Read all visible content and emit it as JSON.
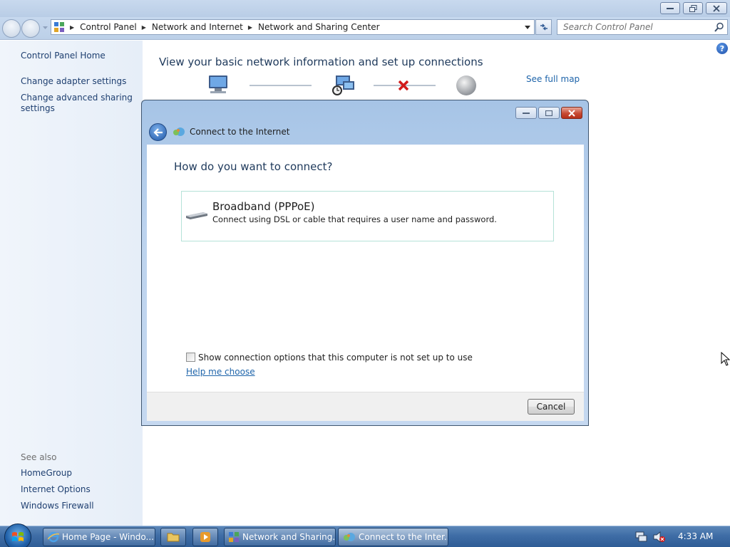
{
  "window": {
    "breadcrumbs": [
      "Control Panel",
      "Network and Internet",
      "Network and Sharing Center"
    ],
    "search_placeholder": "Search Control Panel"
  },
  "sidebar": {
    "items": [
      {
        "label": "Control Panel Home"
      },
      {
        "label": "Change adapter settings"
      },
      {
        "label": "Change advanced sharing settings"
      }
    ],
    "see_also_heading": "See also",
    "see_also": [
      {
        "label": "HomeGroup"
      },
      {
        "label": "Internet Options"
      },
      {
        "label": "Windows Firewall"
      }
    ]
  },
  "main": {
    "title": "View your basic network information and set up connections",
    "see_full_map": "See full map"
  },
  "dialog": {
    "title": "Connect to the Internet",
    "question": "How do you want to connect?",
    "option": {
      "title": "Broadband (PPPoE)",
      "description": "Connect using DSL or cable that requires a user name and password."
    },
    "checkbox_label": "Show connection options that this computer is not set up to use",
    "checkbox_checked": false,
    "help_link": "Help me choose",
    "cancel_label": "Cancel"
  },
  "taskbar": {
    "items": [
      {
        "label": "Home Page - Windo..."
      },
      {
        "label": "Network and Sharing..."
      },
      {
        "label": "Connect to the Inter..."
      }
    ],
    "clock": "4:33 AM"
  },
  "colors": {
    "link": "#1e64aa",
    "heading": "#1e395b",
    "sidebar_link": "#1e3f70",
    "dialog_frame": "#bcd3ee",
    "taskbar": "#3f6da6",
    "close_button": "#c74a32",
    "disconnect_x": "#d11a1a"
  }
}
